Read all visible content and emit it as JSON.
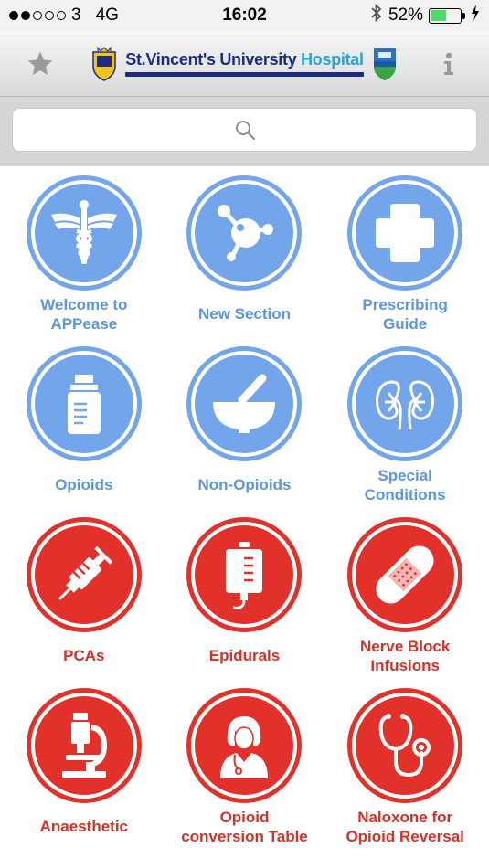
{
  "status_bar": {
    "carrier": "3",
    "network": "4G",
    "time": "16:02",
    "battery": "52%",
    "battery_level": 0.52,
    "signal_bars_filled": 2,
    "signal_bars_total": 5
  },
  "header": {
    "title_main": "St.Vincent's University ",
    "title_accent": "Hospital",
    "brand_color": "#1d2b87",
    "accent_color": "#2aa3d9"
  },
  "search": {
    "placeholder": ""
  },
  "colors": {
    "blue_tile": "#72a5ea",
    "blue_label": "#5c95e0",
    "red_tile": "#e2312b",
    "red_label": "#d63027"
  },
  "tiles": [
    {
      "label": "Welcome to\nAPPease",
      "icon": "caduceus-icon",
      "color": "blue"
    },
    {
      "label": "New Section",
      "icon": "molecule-icon",
      "color": "blue"
    },
    {
      "label": "Prescribing\nGuide",
      "icon": "medical-cross-icon",
      "color": "blue"
    },
    {
      "label": "Opioids",
      "icon": "pill-bottle-icon",
      "color": "blue"
    },
    {
      "label": "Non-Opioids",
      "icon": "mortar-pestle-icon",
      "color": "blue"
    },
    {
      "label": "Special\nConditions",
      "icon": "kidneys-icon",
      "color": "blue"
    },
    {
      "label": "PCAs",
      "icon": "syringe-icon",
      "color": "red"
    },
    {
      "label": "Epidurals",
      "icon": "iv-bag-icon",
      "color": "red"
    },
    {
      "label": "Nerve Block\nInfusions",
      "icon": "bandage-icon",
      "color": "red"
    },
    {
      "label": "Anaesthetic",
      "icon": "microscope-icon",
      "color": "red"
    },
    {
      "label": "Opioid\nconversion Table",
      "icon": "doctor-icon",
      "color": "red"
    },
    {
      "label": "Naloxone for\nOpioid Reversal",
      "icon": "stethoscope-icon",
      "color": "red"
    }
  ]
}
